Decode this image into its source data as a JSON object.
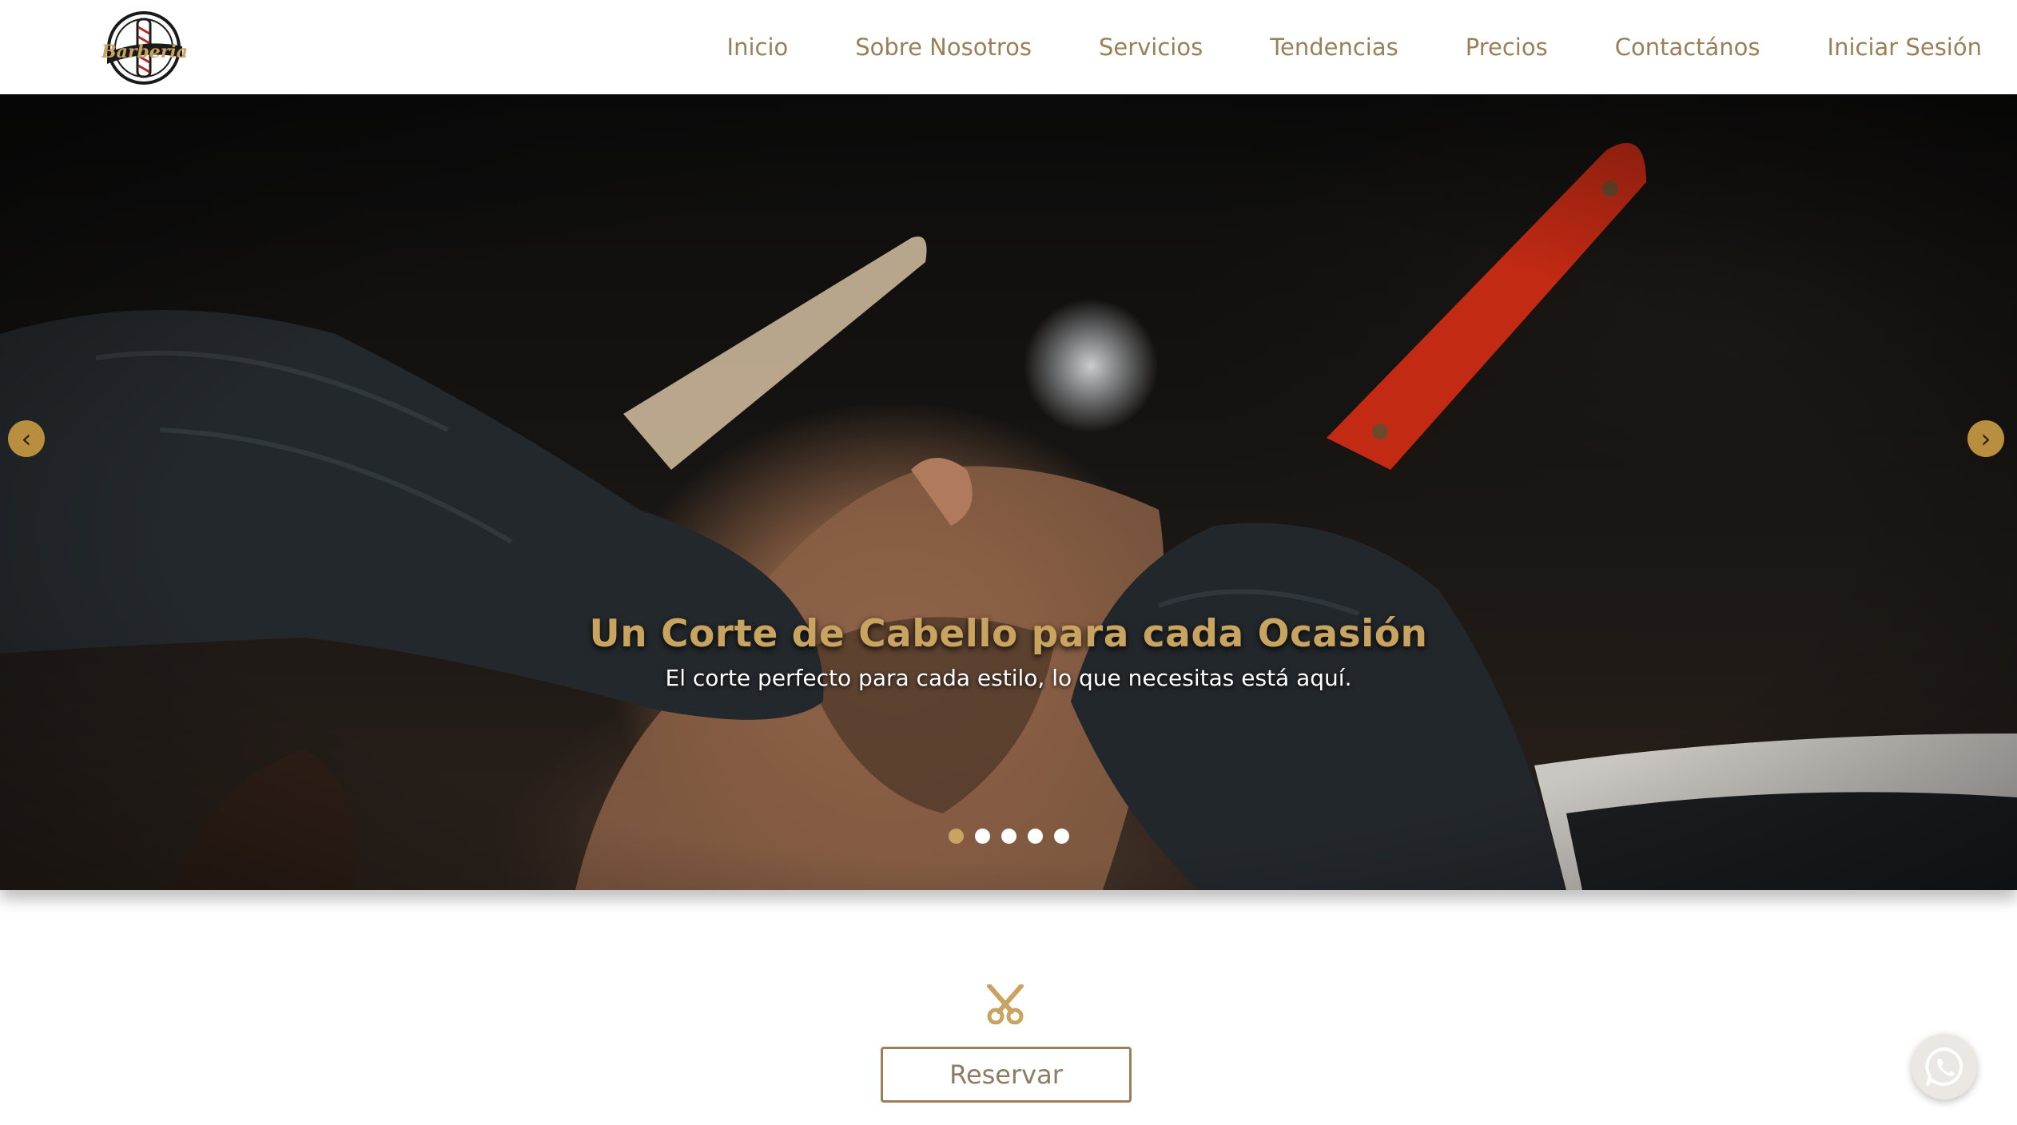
{
  "header": {
    "logo_icon": "barberia-logo",
    "logo_text": "Barberia",
    "nav": [
      {
        "label": "Inicio"
      },
      {
        "label": "Sobre Nosotros"
      },
      {
        "label": "Servicios"
      },
      {
        "label": "Tendencias"
      },
      {
        "label": "Precios"
      },
      {
        "label": "Contactános"
      },
      {
        "label": "Iniciar Sesión"
      }
    ]
  },
  "hero": {
    "title": "Un Corte de Cabello para cada Ocasión",
    "subtitle": "El corte perfecto para cada estilo, lo que necesitas está aquí.",
    "prev_icon": "‹",
    "next_icon": "›",
    "slide_count": 5,
    "active_slide": 1
  },
  "cta": {
    "icon": "scissors-icon",
    "button_label": "Reservar"
  },
  "floating": {
    "icon": "whatsapp-icon"
  },
  "colors": {
    "accent": "#c9a461",
    "nav_text": "#9a8058",
    "button_border": "#9a8058"
  }
}
